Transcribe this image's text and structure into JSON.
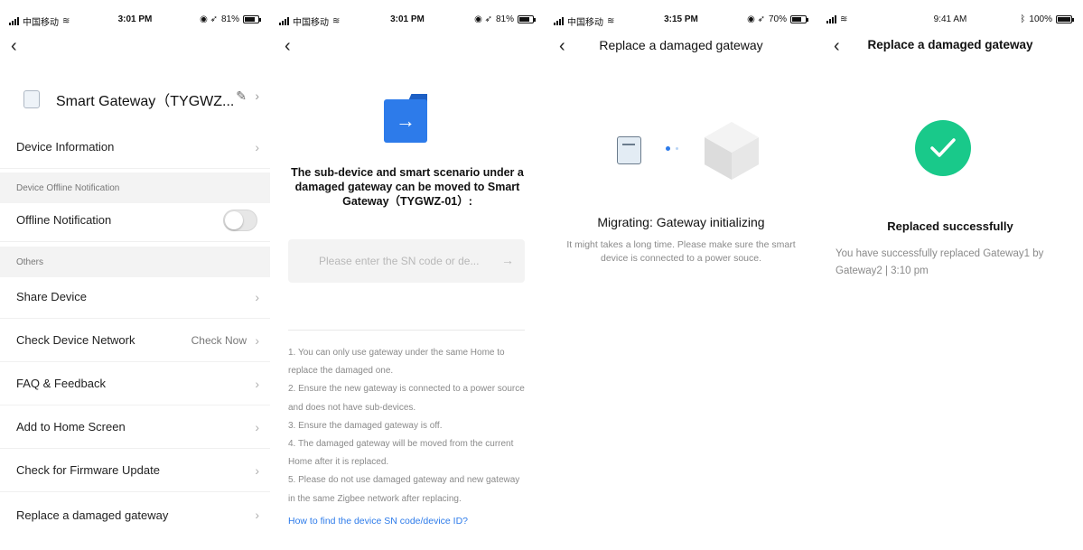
{
  "panel1": {
    "status": {
      "carrier": "中国移动",
      "time": "3:01 PM",
      "battery": "81%",
      "battery_level": 0.81
    },
    "device_name": "Smart Gateway（TYGWZ...",
    "items": [
      {
        "label": "Device Information"
      },
      {
        "label": "Offline Notification"
      },
      {
        "label": "Share Device"
      },
      {
        "label": "Check Device Network",
        "extra": "Check Now"
      },
      {
        "label": "FAQ & Feedback"
      },
      {
        "label": "Add to Home Screen"
      },
      {
        "label": "Check for Firmware Update"
      },
      {
        "label": "Replace a damaged gateway"
      }
    ],
    "sections": [
      "Device Offline Notification",
      "Others"
    ],
    "offline_toggle_on": false
  },
  "panel2": {
    "status": {
      "carrier": "中国移动",
      "time": "3:01 PM",
      "battery": "81%",
      "battery_level": 0.81
    },
    "message": "The sub-device and smart scenario under a damaged gateway can be moved to Smart Gateway（TYGWZ-01）:",
    "input_placeholder": "Please enter the SN code or de...",
    "tips": [
      "1. You can only use gateway under the same Home to replace the damaged one.",
      "2. Ensure the new gateway is connected to a power source and does not have sub-devices.",
      "3. Ensure the damaged gateway is off.",
      "4. The damaged gateway will be moved from the current Home after it is replaced.",
      "5. Please do not use damaged gateway and new gateway in the same Zigbee network after replacing."
    ],
    "help_link": "How to find the device SN code/device ID?"
  },
  "panel3": {
    "status": {
      "carrier": "中国移动",
      "time": "3:15 PM",
      "battery": "70%",
      "battery_level": 0.7
    },
    "title": "Replace a damaged gateway",
    "heading": "Migrating: Gateway initializing",
    "description": "It might takes a long time. Please make sure the smart device is connected to a power souce."
  },
  "panel4": {
    "status": {
      "time": "9:41 AM",
      "battery": "100%",
      "battery_level": 1.0
    },
    "title": "Replace a damaged gateway",
    "heading": "Replaced successfully",
    "description": "You have successfully replaced Gateway1 by Gateway2 | 3:10 pm"
  },
  "colors": {
    "accent": "#2d7bea",
    "success": "#19c98a",
    "muted": "#8a8a8a"
  },
  "icons": [
    "back-chevron-icon",
    "edit-pencil-icon",
    "chevron-right-icon",
    "folder-arrow-icon",
    "phone-device-icon",
    "gateway-cube-icon",
    "checkmark-icon",
    "wifi-icon",
    "battery-icon",
    "bluetooth-icon",
    "location-icon"
  ]
}
